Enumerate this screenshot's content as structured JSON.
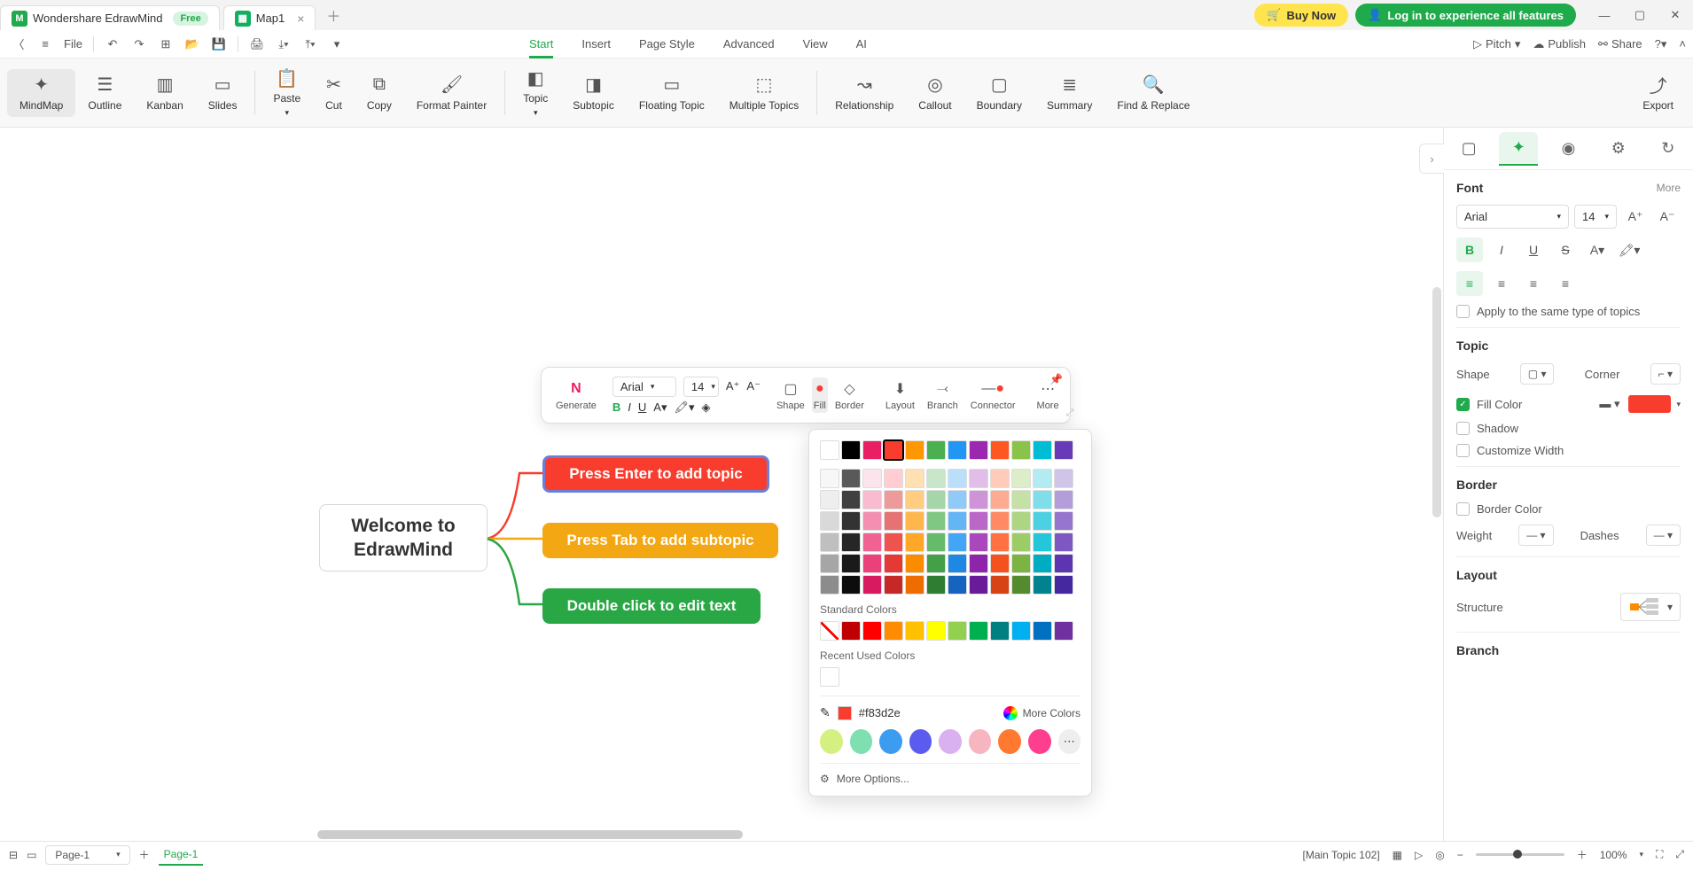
{
  "titlebar": {
    "app_name": "Wondershare EdrawMind",
    "free_badge": "Free",
    "doc_name": "Map1",
    "buy_now": "Buy Now",
    "login": "Log in to experience all features"
  },
  "toolbar": {
    "file": "File",
    "pitch": "Pitch",
    "publish": "Publish",
    "share": "Share",
    "menus": [
      "Start",
      "Insert",
      "Page Style",
      "Advanced",
      "View",
      "AI"
    ],
    "active_menu": 0
  },
  "ribbon": {
    "views": [
      "MindMap",
      "Outline",
      "Kanban",
      "Slides"
    ],
    "actions": [
      "Paste",
      "Cut",
      "Copy",
      "Format Painter"
    ],
    "topics": [
      "Topic",
      "Subtopic",
      "Floating Topic",
      "Multiple Topics"
    ],
    "extras": [
      "Relationship",
      "Callout",
      "Boundary",
      "Summary",
      "Find & Replace"
    ],
    "export": "Export"
  },
  "mindmap": {
    "central": "Welcome to EdrawMind",
    "t1": "Press Enter to add topic",
    "t2": "Press Tab to add subtopic",
    "t3": "Double click to edit text"
  },
  "float_toolbar": {
    "generate": "Generate",
    "font": "Arial",
    "size": "14",
    "shape": "Shape",
    "fill": "Fill",
    "border": "Border",
    "layout": "Layout",
    "branch": "Branch",
    "connector": "Connector",
    "more": "More"
  },
  "color_popup": {
    "row_main": [
      "#ffffff",
      "#000000",
      "#e91e63",
      "#f83d2e",
      "#ff9800",
      "#4caf50",
      "#2196f3",
      "#9c27b0",
      "#ff5722",
      "#8bc34a",
      "#00bcd4",
      "#673ab7"
    ],
    "shades": [
      [
        "#f7f7f7",
        "#595959",
        "#fce4ec",
        "#ffcdd2",
        "#ffe0b2",
        "#c8e6c9",
        "#bbdefb",
        "#e1bee7",
        "#ffccbc",
        "#dcedc8",
        "#b2ebf2",
        "#d1c4e9"
      ],
      [
        "#eeeeee",
        "#404040",
        "#f8bbd0",
        "#ef9a9a",
        "#ffcc80",
        "#a5d6a7",
        "#90caf9",
        "#ce93d8",
        "#ffab91",
        "#c5e1a5",
        "#80deea",
        "#b39ddb"
      ],
      [
        "#d9d9d9",
        "#333333",
        "#f48fb1",
        "#e57373",
        "#ffb74d",
        "#81c784",
        "#64b5f6",
        "#ba68c8",
        "#ff8a65",
        "#aed581",
        "#4dd0e1",
        "#9575cd"
      ],
      [
        "#bfbfbf",
        "#262626",
        "#f06292",
        "#ef5350",
        "#ffa726",
        "#66bb6a",
        "#42a5f5",
        "#ab47bc",
        "#ff7043",
        "#9ccc65",
        "#26c6da",
        "#7e57c2"
      ],
      [
        "#a6a6a6",
        "#1a1a1a",
        "#ec407a",
        "#e53935",
        "#fb8c00",
        "#43a047",
        "#1e88e5",
        "#8e24aa",
        "#f4511e",
        "#7cb342",
        "#00acc1",
        "#5e35b1"
      ],
      [
        "#8c8c8c",
        "#0d0d0d",
        "#d81b60",
        "#c62828",
        "#ef6c00",
        "#2e7d32",
        "#1565c0",
        "#6a1b9a",
        "#d84315",
        "#558b2f",
        "#00838f",
        "#4527a0"
      ]
    ],
    "standard_label": "Standard Colors",
    "standard": [
      "#ffffff",
      "#c00000",
      "#ff0000",
      "#ff8c00",
      "#ffc000",
      "#ffff00",
      "#92d050",
      "#00b050",
      "#008080",
      "#00b0f0",
      "#0070c0",
      "#7030a0"
    ],
    "recent_label": "Recent Used Colors",
    "recent": [
      "#ffffff"
    ],
    "hex": "#f83d2e",
    "more_colors": "More Colors",
    "gradients": [
      "#d4f081",
      "#7ee0b0",
      "#3b9cf0",
      "#5b5bf0",
      "#d9b0f0",
      "#f7b5c0",
      "#ff7a30",
      "#ff3e8e"
    ],
    "more_options": "More Options..."
  },
  "right_panel": {
    "font_title": "Font",
    "more": "More",
    "font_family": "Arial",
    "font_size": "14",
    "apply_same": "Apply to the same type of topics",
    "topic_title": "Topic",
    "shape_label": "Shape",
    "corner_label": "Corner",
    "fill_color_label": "Fill Color",
    "shadow_label": "Shadow",
    "custom_width_label": "Customize Width",
    "border_title": "Border",
    "border_color_label": "Border Color",
    "weight_label": "Weight",
    "dashes_label": "Dashes",
    "layout_title": "Layout",
    "structure_label": "Structure",
    "branch_title": "Branch"
  },
  "statusbar": {
    "page_select": "Page-1",
    "page_tab": "Page-1",
    "selection": "[Main Topic 102]",
    "zoom": "100%"
  }
}
